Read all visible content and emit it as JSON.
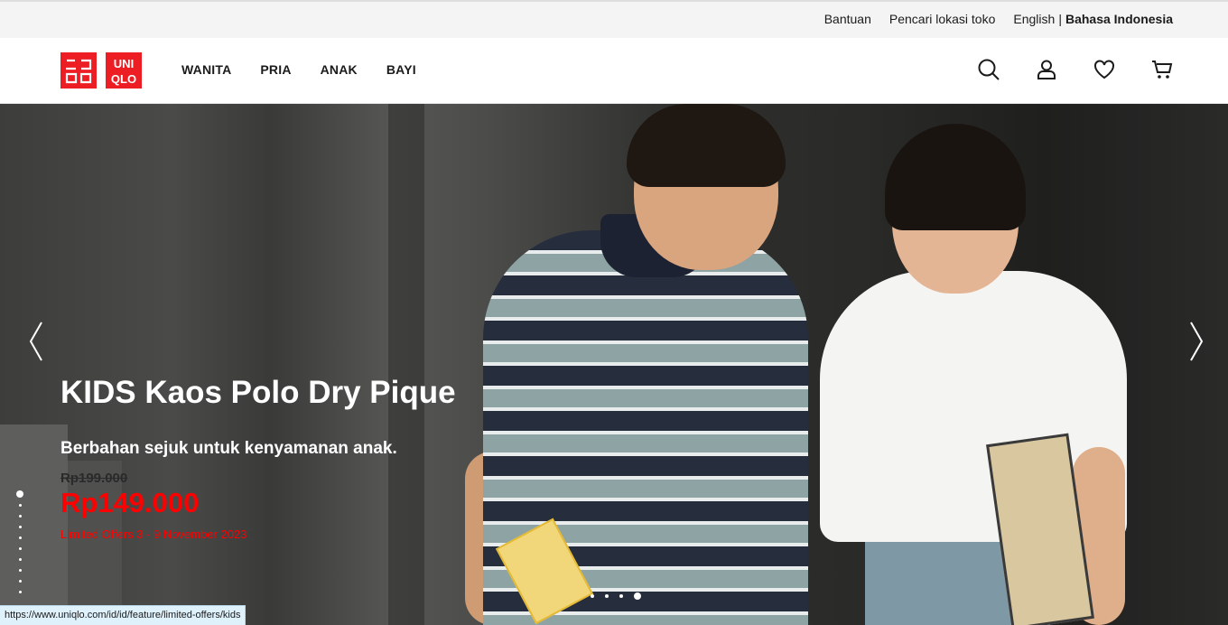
{
  "utility": {
    "help": "Bantuan",
    "store_locator": "Pencari lokasi toko",
    "lang_en": "English",
    "lang_sep": "|",
    "lang_id": "Bahasa Indonesia"
  },
  "header": {
    "logo_text": [
      "ユニ",
      "クロ",
      "UNI",
      "QLO"
    ],
    "nav": [
      "WANITA",
      "PRIA",
      "ANAK",
      "BAYI"
    ],
    "icons": [
      "search-icon",
      "account-icon",
      "wishlist-icon",
      "cart-icon"
    ]
  },
  "hero": {
    "title": "KIDS Kaos Polo Dry Pique",
    "subtitle": "Berbahan sejuk untuk kenyamanan anak.",
    "price_old": "Rp199.000",
    "price_new": "Rp149.000",
    "offer_note": "Limited Offers 3 - 9 November 2023",
    "vertical_dots": {
      "count": 10,
      "active": 0
    },
    "horizontal_dots": {
      "count": 4,
      "active": 3
    }
  },
  "status_bar": {
    "url": "https://www.uniqlo.com/id/id/feature/limited-offers/kids"
  },
  "colors": {
    "brand_red": "#ed1d24",
    "price_red": "#ff0000",
    "utility_bg": "#f4f4f4"
  }
}
